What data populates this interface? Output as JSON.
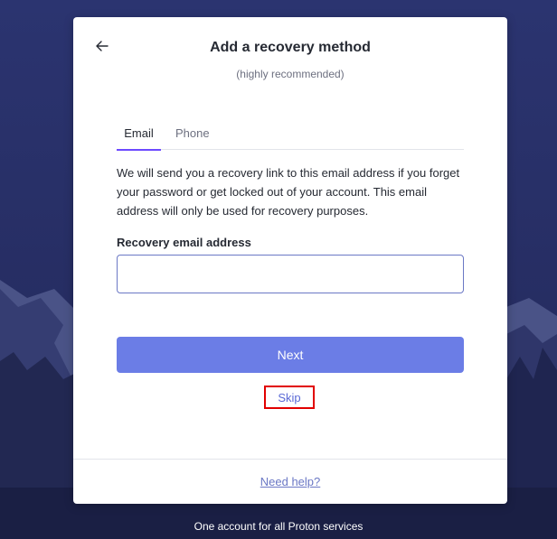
{
  "dialog": {
    "title": "Add a recovery method",
    "subtitle": "(highly recommended)",
    "back_icon": "arrow-left-icon",
    "tabs": [
      {
        "label": "Email",
        "active": true
      },
      {
        "label": "Phone",
        "active": false
      }
    ],
    "description": "We will send you a recovery link to this email address if you forget your password or get locked out of your account. This email address will only be used for recovery purposes.",
    "field_label": "Recovery email address",
    "field_value": "",
    "next_label": "Next",
    "skip_label": "Skip",
    "help_label": "Need help?"
  },
  "footer": {
    "text": "One account for all Proton services"
  },
  "colors": {
    "background": "#1f2550",
    "primary": "#6b7de6",
    "tab_accent": "#6d4aff",
    "skip_highlight": "#e10000"
  }
}
